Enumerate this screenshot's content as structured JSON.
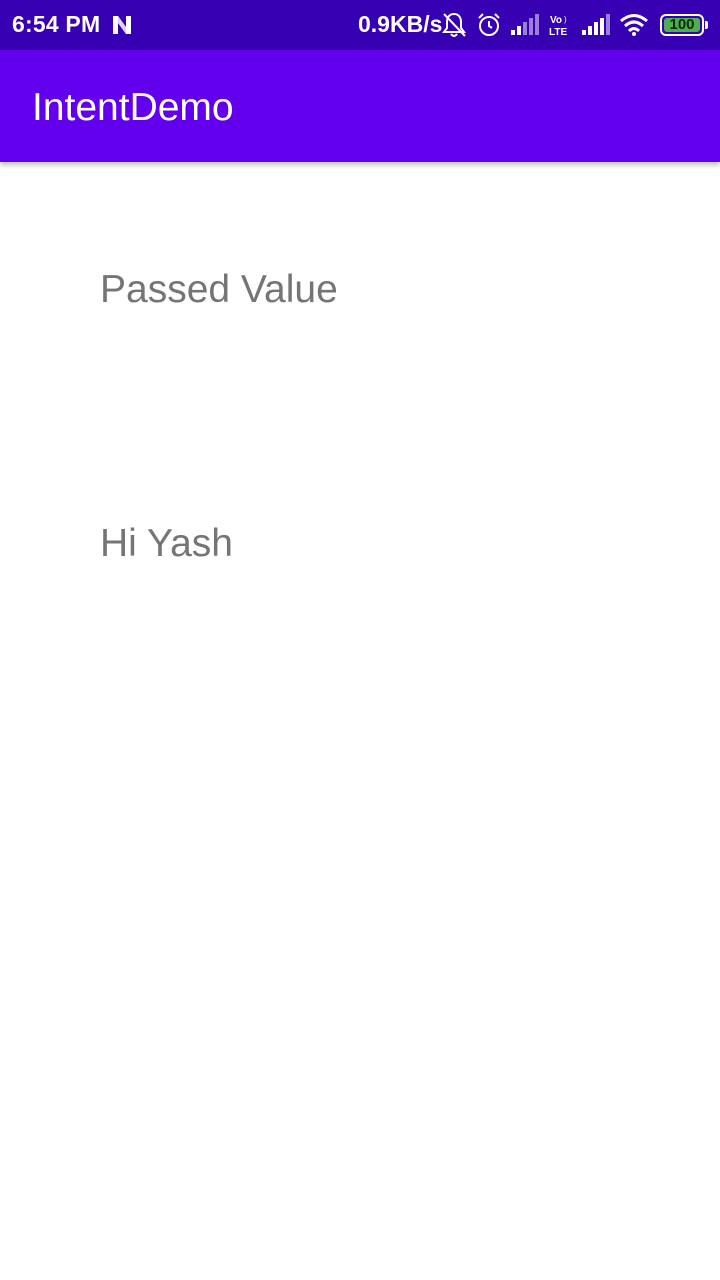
{
  "status_bar": {
    "time": "6:54 PM",
    "net_speed": "0.9KB/s",
    "battery_level": "100",
    "colors": {
      "background": "#3700B3",
      "battery_fill": "#4CAF50"
    },
    "icons": [
      "n-icon",
      "mute-bell-icon",
      "alarm-icon",
      "signal-icon",
      "volte-lte-icon",
      "signal-icon",
      "wifi-icon",
      "battery-icon"
    ]
  },
  "app_bar": {
    "title": "IntentDemo",
    "background": "#6200EE"
  },
  "main": {
    "label_1": "Passed Value",
    "label_2": "Hi Yash"
  }
}
